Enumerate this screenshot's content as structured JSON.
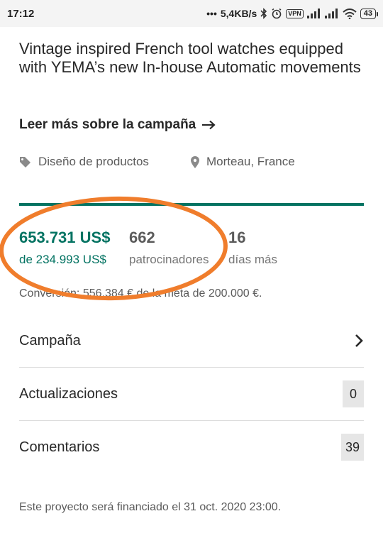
{
  "status_bar": {
    "time": "17:12",
    "network_speed": "5,4KB/s",
    "vpn_label": "VPN",
    "battery": "43"
  },
  "project": {
    "title": "Vintage inspired French tool watches equipped with YEMA’s new In-house Automatic movements",
    "read_more": "Leer más sobre la campaña",
    "category": "Diseño de productos",
    "location": "Morteau, France",
    "funded_fraction": 1.0
  },
  "stats": {
    "pledged": {
      "value": "653.731 US$",
      "label": "de 234.993 US$"
    },
    "backers": {
      "value": "662",
      "label": "patrocinadores"
    },
    "days": {
      "value": "16",
      "label": "días más"
    },
    "conversion": "Conversión: 556.384 € de la meta de 200.000 €."
  },
  "nav": [
    {
      "label": "Campaña",
      "icon": "chevron-right-icon"
    },
    {
      "label": "Actualizaciones",
      "count": "0"
    },
    {
      "label": "Comentarios",
      "count": "39"
    }
  ],
  "footer_note": "Este proyecto será financiado el 31 oct. 2020 23:00.",
  "colors": {
    "accent": "#037362",
    "annotation": "#f07d2c"
  }
}
